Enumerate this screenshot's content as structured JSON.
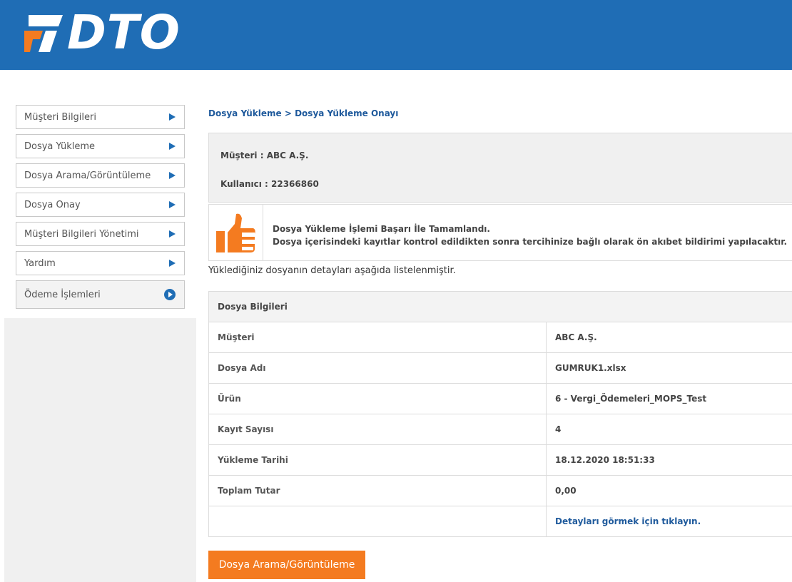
{
  "header": {
    "logo_text": "DTO",
    "brand_color": "#1f6db5"
  },
  "sidebar": {
    "items": [
      {
        "label": "Müşteri Bilgileri",
        "icon": "arrow-right-icon"
      },
      {
        "label": "Dosya Yükleme",
        "icon": "arrow-right-icon"
      },
      {
        "label": "Dosya Arama/Görüntüleme",
        "icon": "arrow-right-icon"
      },
      {
        "label": "Dosya Onay",
        "icon": "arrow-right-icon"
      },
      {
        "label": "Müşteri Bilgileri Yönetimi",
        "icon": "arrow-right-icon"
      },
      {
        "label": "Yardım",
        "icon": "arrow-right-icon"
      },
      {
        "label": "Ödeme İşlemleri",
        "icon": "play-circle-icon"
      }
    ]
  },
  "main": {
    "breadcrumb": "Dosya Yükleme > Dosya Yükleme Onayı",
    "customer_line": "Müşteri :  ABC A.Ş.",
    "user_line": "Kullanıcı : 22366860",
    "success_title": "Dosya Yükleme İşlemi Başarı İle Tamamlandı.",
    "success_detail": "Dosya içerisindeki kayıtlar kontrol edildikten sonra tercihinize bağlı olarak ön akıbet bildirimi yapılacaktır.",
    "intro": "Yüklediğiniz dosyanın detayları aşağıda listelenmiştir.",
    "details": {
      "title": "Dosya Bilgileri",
      "rows": [
        {
          "key": "Müşteri",
          "value": "ABC A.Ş."
        },
        {
          "key": "Dosya Adı",
          "value": "GUMRUK1.xlsx"
        },
        {
          "key": "Ürün",
          "value": "6 - Vergi_Ödemeleri_MOPS_Test"
        },
        {
          "key": "Kayıt Sayısı",
          "value": "4"
        },
        {
          "key": "Yükleme Tarihi",
          "value": "18.12.2020 18:51:33"
        },
        {
          "key": "Toplam Tutar",
          "value": "0,00"
        }
      ],
      "link_label": "Detayları görmek için tıklayın."
    },
    "search_button": "Dosya Arama/Görüntüleme",
    "accent_color": "#f47b20"
  }
}
